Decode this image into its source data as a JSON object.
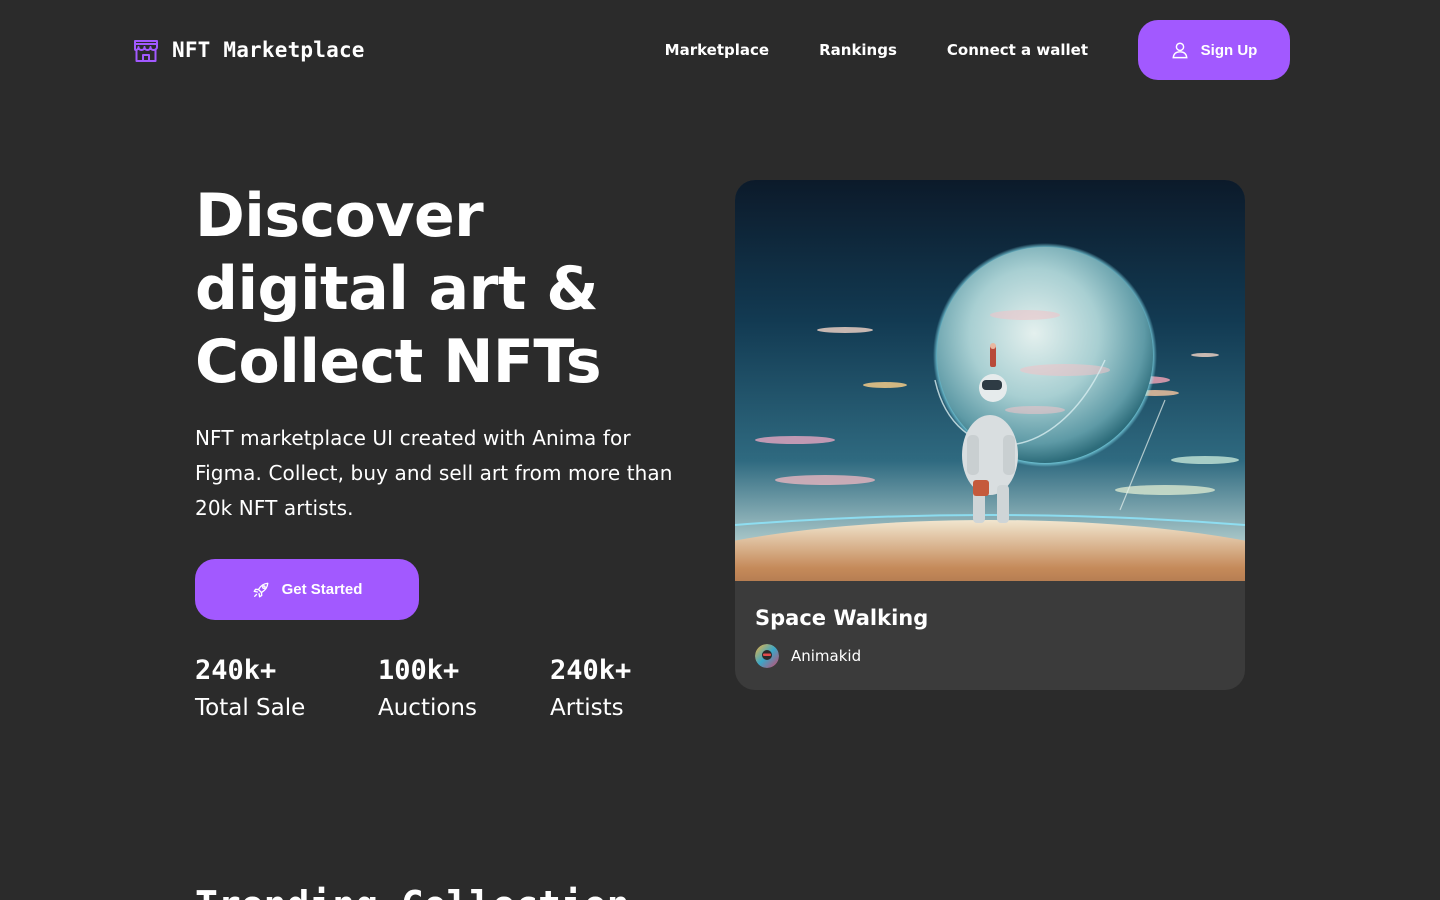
{
  "header": {
    "brand_name": "NFT Marketplace",
    "brand_icon": "storefront-icon",
    "nav": [
      {
        "label": "Marketplace"
      },
      {
        "label": "Rankings"
      },
      {
        "label": "Connect a wallet"
      }
    ],
    "signup_label": "Sign Up",
    "signup_icon": "user-icon"
  },
  "hero": {
    "title_lines": [
      "Discover",
      "digital art &",
      "Collect NFTs"
    ],
    "subtitle": "NFT marketplace UI created with Anima for Figma. Collect, buy and sell art from more than 20k NFT artists.",
    "cta_label": "Get Started",
    "cta_icon": "rocket-icon",
    "stats": [
      {
        "value": "240k+",
        "label": "Total Sale"
      },
      {
        "value": "100k+",
        "label": "Auctions"
      },
      {
        "value": "240k+",
        "label": "Artists"
      }
    ]
  },
  "featured": {
    "title": "Space Walking",
    "artist": "Animakid"
  },
  "next_section": {
    "heading": "Trending Collection"
  },
  "colors": {
    "background": "#2b2b2b",
    "accent": "#a259ff",
    "card": "#3b3b3b",
    "text": "#ffffff"
  }
}
